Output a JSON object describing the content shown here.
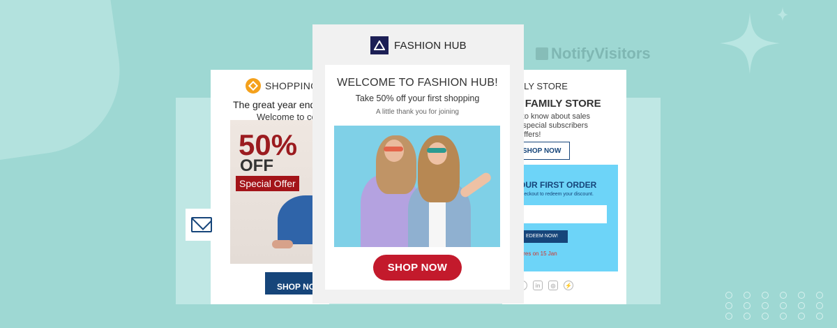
{
  "brand": {
    "name": "NotifyVisitors"
  },
  "left_card": {
    "brand": "SHOPPING",
    "tagline": "The great year end",
    "welcome": "Welcome to co",
    "percent": "50%",
    "off": "OFF",
    "badge": "Special Offer",
    "button": "SHOP NO"
  },
  "center_card": {
    "brand": "FASHION HUB",
    "title": "WELCOME TO FASHION HUB!",
    "subtitle": "Take 50% off your first shopping",
    "thanks": "A little thank you for joining",
    "button": "SHOP NOW"
  },
  "right_card": {
    "brand": "AMILY STORE",
    "title": "TO FAMILY STORE",
    "desc": [
      "first to know about sales",
      "and special subscribers",
      "nly offers!"
    ],
    "shop_button": "SHOP NOW",
    "box_title": "OUR FIRST ORDER",
    "box_sub": "checkout to redeem your discount.",
    "redeem_button": "EDEEM NOW!",
    "expiry": "pires on 15 Jan",
    "social": [
      "twitter-icon",
      "linkedin-icon",
      "instagram-icon",
      "messenger-icon"
    ]
  },
  "colors": {
    "background": "#9ed8d3",
    "navy": "#16457a",
    "red": "#c31a2c",
    "cyan_box": "#6dd4f8"
  }
}
